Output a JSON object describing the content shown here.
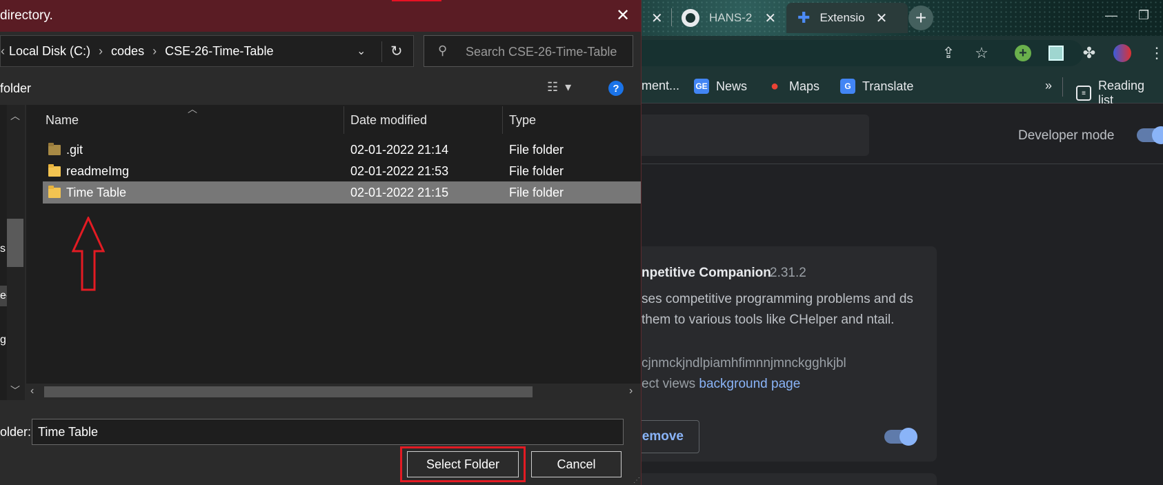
{
  "dialog": {
    "title": "directory.",
    "address": {
      "crumbs": [
        "Local Disk (C:)",
        "codes",
        "CSE-26-Time-Table"
      ]
    },
    "search_placeholder": "Search CSE-26-Time-Table",
    "command_label": "folder",
    "nav_labels": [
      "s",
      "e-",
      "g"
    ],
    "columns": {
      "name": "Name",
      "date": "Date modified",
      "type": "Type"
    },
    "files": [
      {
        "name": ".git",
        "date": "02-01-2022 21:14",
        "type": "File folder"
      },
      {
        "name": "readmeImg",
        "date": "02-01-2022 21:53",
        "type": "File folder"
      },
      {
        "name": "Time Table",
        "date": "02-01-2022 21:15",
        "type": "File folder"
      }
    ],
    "folder_label": "older:",
    "folder_value": "Time Table",
    "select_label": "Select Folder",
    "cancel_label": "Cancel"
  },
  "chrome": {
    "tabs": [
      {
        "title": "HANS-2"
      },
      {
        "title": "Extensio"
      }
    ],
    "bookmarks": {
      "partial": "ment...",
      "news": "News",
      "maps": "Maps",
      "translate": "Translate",
      "reading_list": "Reading list",
      "more": "»"
    },
    "developer_mode": "Developer mode",
    "extension": {
      "name": "npetitive Companion",
      "version": "2.31.2",
      "description": "ses competitive programming problems and ds them to various tools like CHelper and ntail.",
      "id": "cjnmckjndlpiamhfimnnjmnckgghkjbl",
      "views_label": "ect views",
      "views_link": "background page",
      "remove_label": "emove"
    }
  },
  "colors": {
    "titlebar": "#5a1c24",
    "highlight": "#e31b23",
    "accent": "#8ab4f8",
    "selected_row": "#777777"
  },
  "icons": {
    "folder": "folder-icon",
    "search": "search-icon",
    "refresh": "refresh-icon",
    "help": "help-icon",
    "close": "close-icon"
  }
}
